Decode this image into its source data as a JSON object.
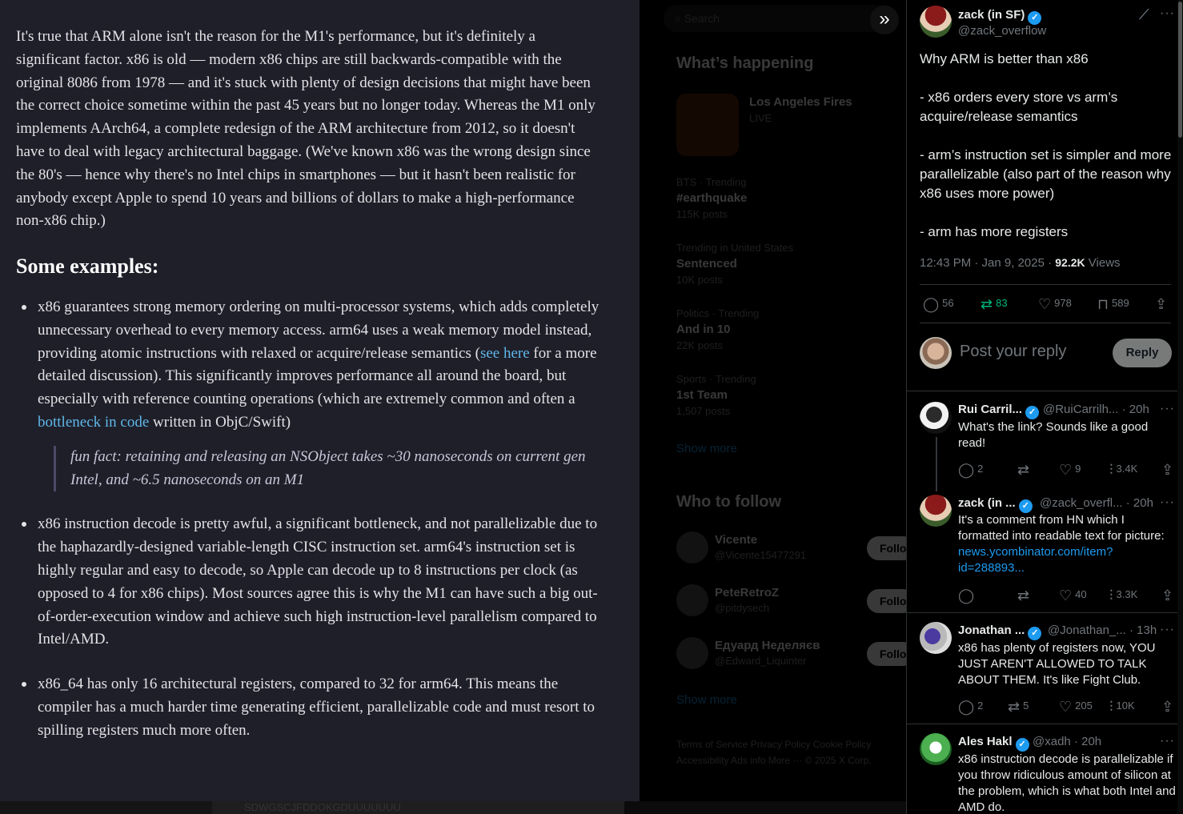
{
  "article": {
    "paragraph": "It's true that ARM alone isn't the reason for the M1's performance, but it's definitely a significant factor. x86 is old — modern x86 chips are still backwards-compatible with the original 8086 from 1978 — and it's stuck with plenty of design decisions that might have been the correct choice sometime within the past 45 years but no longer today. Whereas the M1 only implements AArch64, a complete redesign of the ARM architecture from 2012, so it doesn't have to deal with legacy architectural baggage. (We've known x86 was the wrong design since the 80's — hence why there's no Intel chips in smartphones — but it hasn't been realistic for anybody except Apple to spend 10 years and billions of dollars to make a high-performance non-x86 chip.)",
    "heading": "Some examples:",
    "bullet1": {
      "part1": "x86 guarantees strong memory ordering on multi-processor systems, which adds completely unnecessary overhead to every memory access. arm64 uses a weak memory model instead, providing atomic instructions with relaxed or acquire/release semantics (",
      "link1": "see here",
      "part2": " for a more detailed discussion). This significantly improves performance all around the board, but especially with reference counting operations (which are extremely common and often a ",
      "link2": "bottleneck in code",
      "part3": " written in ObjC/Swift)",
      "quote": "fun fact: retaining and releasing an NSObject takes ~30 nanoseconds on current gen Intel, and ~6.5 nanoseconds on an M1"
    },
    "bullet2": "x86 instruction decode is pretty awful, a significant bottleneck, and not parallelizable due to the haphazardly-designed variable-length CISC instruction set. arm64's instruction set is highly regular and easy to decode, so Apple can decode up to 8 instructions per clock (as opposed to 4 for x86 chips). Most sources agree this is why the M1 can have such a big out-of-order-execution window and achieve such high instruction-level parallelism compared to Intel/AMD.",
    "bullet3": "x86_64 has only 16 architectural registers, compared to 32 for arm64. This means the compiler has a much harder time generating efficient, parallelizable code and must resort to spilling registers much more often."
  },
  "bottom_strip": {
    "text": "SDWGSCJFDDOKGDUUUUUUU"
  },
  "sidebar": {
    "search_placeholder": "Search",
    "whats_happening": "What’s happening",
    "fire": {
      "title": "Los Angeles Fires",
      "meta": "LIVE"
    },
    "trends": [
      {
        "context": "BTS · Trending",
        "name": "#earthquake",
        "posts": "115K posts"
      },
      {
        "context": "Trending in United States",
        "name": "Sentenced",
        "posts": "10K posts"
      },
      {
        "context": "Politics · Trending",
        "name": "And in 10",
        "posts": "22K posts"
      },
      {
        "context": "Sports · Trending",
        "name": "1st Team",
        "posts": "1,507 posts"
      }
    ],
    "show_more": "Show more",
    "who_to_follow": "Who to follow",
    "follow_users": [
      {
        "name": "Vicente",
        "handle": "@Vicente15477291",
        "button": "Follow"
      },
      {
        "name": "PeteRetroZ",
        "handle": "@pitdysech",
        "button": "Follow"
      },
      {
        "name": "Едуард Неделяєв",
        "handle": "@Edward_Liquinter",
        "button": "Follow"
      }
    ],
    "show_more_2": "Show more",
    "footer": "Terms of Service  Privacy Policy  Cookie Policy  Accessibility  Ads info  More ···  © 2025 X Corp."
  },
  "thread": {
    "author": {
      "name": "zack (in SF)",
      "handle": "@zack_overflow"
    },
    "text": "Why ARM is better than x86\n\n- x86 orders every store vs arm’s acquire/release semantics\n\n- arm’s instruction set is simpler and more parallelizable (also part of the reason why x86 uses more power)\n\n- arm has more registers",
    "timestamp": "12:43 PM · Jan 9, 2025 · ",
    "views_count": "92.2K",
    "views_label": " Views",
    "stats": {
      "replies": "56",
      "reposts": "83",
      "likes": "978",
      "bookmarks": "589"
    },
    "reply_placeholder": "Post your reply",
    "reply_button": "Reply",
    "replies": [
      {
        "name": "Rui Carril...",
        "handle": "@RuiCarrilh...",
        "time": "· 20h",
        "text": "What's the link? Sounds like a good read!",
        "replies": "2",
        "reposts": "",
        "likes": "9",
        "views": "3.4K"
      },
      {
        "name": "zack (in ...",
        "handle": "@zack_overfl...",
        "time": "· 20h",
        "text": "It's a comment from HN which I formatted into readable text for picture: ",
        "link": "news.ycombinator.com/item?id=288893...",
        "replies": "",
        "reposts": "",
        "likes": "40",
        "views": "3.3K"
      },
      {
        "name": "Jonathan ...",
        "handle": "@Jonathan_...",
        "time": "· 13h",
        "text": "x86 has plenty of registers now, YOU JUST AREN'T ALLOWED TO TALK ABOUT THEM. It's like Fight Club.",
        "replies": "2",
        "reposts": "5",
        "likes": "205",
        "views": "10K"
      },
      {
        "name": "Ales Hakl",
        "handle": "@xadh",
        "time": "· 20h",
        "text": "x86 instruction decode is parallelizable if you throw ridiculous amount of silicon at the problem, which is what both Intel and AMD do."
      }
    ]
  },
  "colors": {
    "accent": "#1d9bf0",
    "repost_green": "#00ba7c",
    "article_bg": "#1f1f2a",
    "link": "#5fb8e8"
  }
}
